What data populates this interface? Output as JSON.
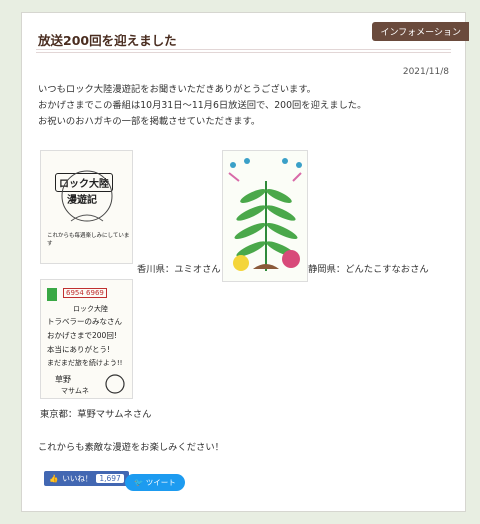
{
  "post": {
    "title": "放送200回を迎えました",
    "category": "インフォメーション",
    "date": "2021/11/8",
    "body": [
      "いつもロック大陸漫遊記をお聞きいただきありがとうございます。",
      "おかげさまでこの番組は10月31日〜11月6日放送回で、200回を迎えました。",
      "お祝いのおハガキの一部を掲載させていただきます。"
    ],
    "postcards": [
      {
        "caption": "香川県：ユミオさん",
        "lines": [
          "ロック大陸",
          "漫遊記",
          "これからも毎週楽しみにしています"
        ]
      },
      {
        "caption": "静岡県：どんたこすなおさん"
      },
      {
        "caption": "東京都：草野マサムネさん",
        "lines": [
          "6954 6969",
          "ロック大陸",
          "トラベラーのみなさん",
          "おかげさまで200回!",
          "本当にありがとう!",
          "まだまだ旅を続けよう!!",
          "草野",
          "マサムネ"
        ]
      }
    ],
    "closing": "これからも素敵な漫遊をお楽しみください！"
  },
  "social": {
    "like_label": "いいね！",
    "like_count": "1,697",
    "tweet_label": "ツイート"
  }
}
